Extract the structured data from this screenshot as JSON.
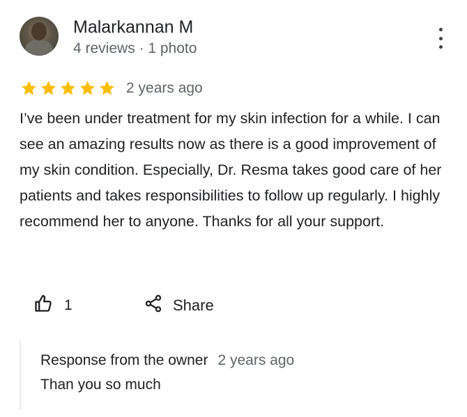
{
  "reviewer": {
    "name": "Malarkannan M",
    "meta": "4 reviews · 1 photo"
  },
  "review": {
    "rating": 5,
    "max_rating": 5,
    "star_color": "#fbbc04",
    "date": "2 years ago",
    "text": "I’ve been under treatment for my skin infection for a while. I can see an amazing results now as there is a good improvement of my skin condition. Especially, Dr. Resma takes good care of her patients and takes responsibilities to follow up regularly. I highly recommend her to anyone. Thanks for all your support."
  },
  "actions": {
    "like_icon": "thumbs-up-icon",
    "like_count": "1",
    "share_icon": "share-icon",
    "share_label": "Share",
    "more_icon": "more-vertical-icon"
  },
  "owner_response": {
    "title": "Response from the owner",
    "date": "2 years ago",
    "text": "Than you so much"
  }
}
